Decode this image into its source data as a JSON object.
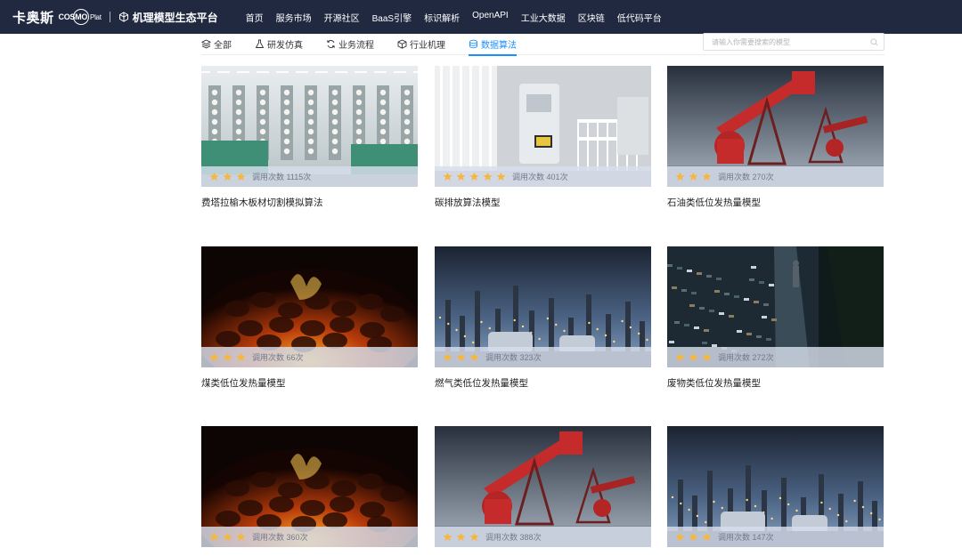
{
  "header": {
    "brand_cn": "卡奥斯",
    "brand_en": "COSMO",
    "brand_plat": "Plat",
    "platform_title": "机理模型生态平台",
    "nav": [
      "首页",
      "服务市场",
      "开源社区",
      "BaaS引擎",
      "标识解析",
      "OpenAPI",
      "工业大数据",
      "区块链",
      "低代码平台"
    ]
  },
  "tabs": [
    {
      "label": "全部",
      "icon": "layers-icon"
    },
    {
      "label": "研发仿真",
      "icon": "flask-icon"
    },
    {
      "label": "业务流程",
      "icon": "refresh-icon"
    },
    {
      "label": "行业机理",
      "icon": "box-icon"
    },
    {
      "label": "数据算法",
      "icon": "stack-icon",
      "active": true
    }
  ],
  "search": {
    "placeholder": "请输入你需要搜索的模型"
  },
  "calls_label": "调用次数",
  "calls_suffix": "次",
  "cards": [
    {
      "title": "费塔拉榆木板材切割模拟算法",
      "calls": "1115",
      "stars": 3,
      "image": "textile-factory"
    },
    {
      "title": "碳排放算法模型",
      "calls": "401",
      "stars": 5,
      "image": "industrial-machine"
    },
    {
      "title": "石油类低位发热量模型",
      "calls": "270",
      "stars": 3,
      "image": "oil-pumpjack"
    },
    {
      "title": "煤类低位发热量模型",
      "calls": "66",
      "stars": 3,
      "image": "burning-coal"
    },
    {
      "title": "燃气类低位发热量模型",
      "calls": "323",
      "stars": 3,
      "image": "refinery-night"
    },
    {
      "title": "废物类低位发热量模型",
      "calls": "272",
      "stars": 3,
      "image": "polluted-river"
    },
    {
      "title": "",
      "calls": "360",
      "stars": 3,
      "image": "burning-coal"
    },
    {
      "title": "",
      "calls": "388",
      "stars": 3,
      "image": "oil-pumpjack"
    },
    {
      "title": "",
      "calls": "147",
      "stars": 3,
      "image": "refinery-night"
    }
  ],
  "colors": {
    "header_bg": "#202940",
    "accent": "#1890ff",
    "star": "#f6b73c"
  }
}
